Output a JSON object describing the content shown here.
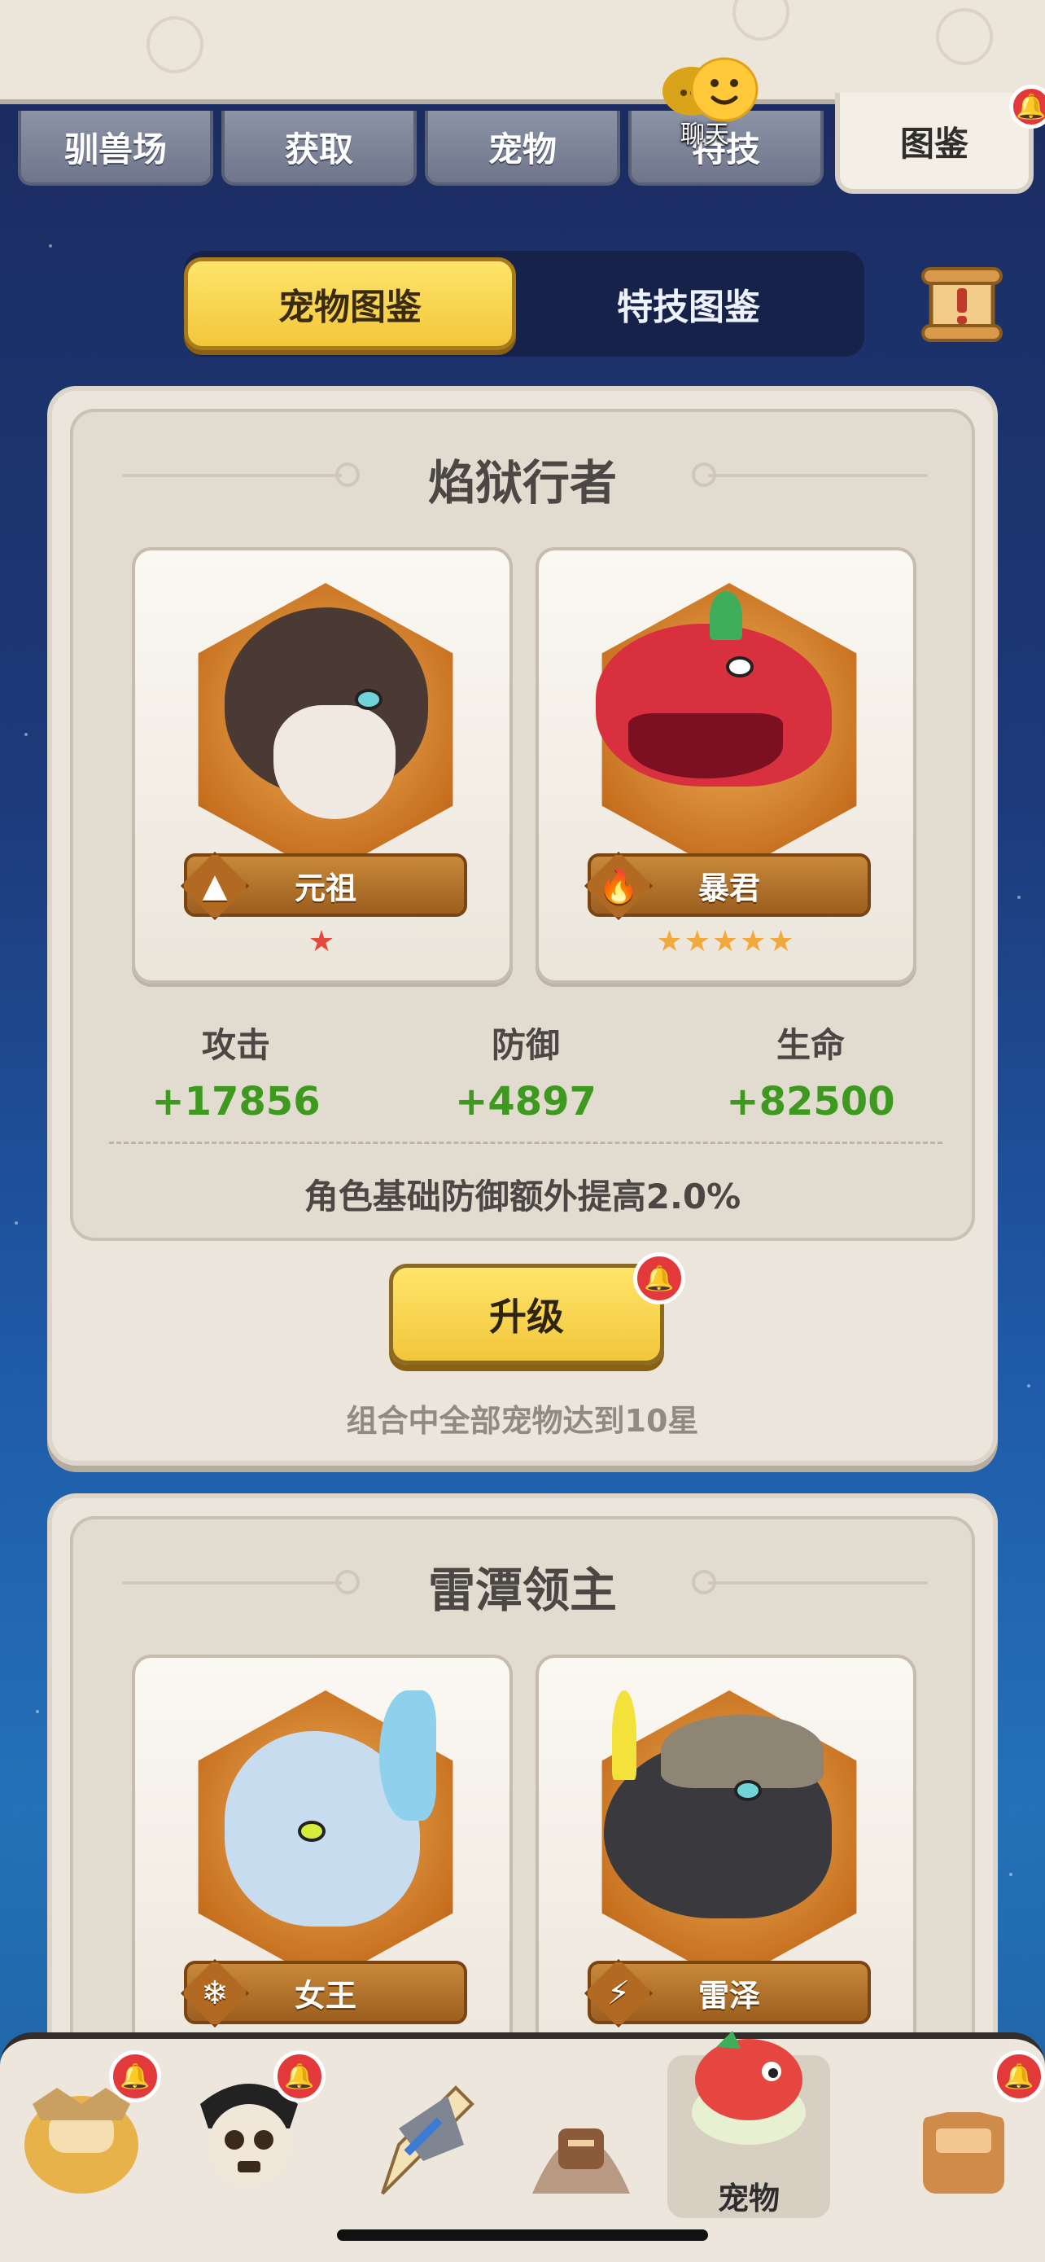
{
  "tabs": [
    {
      "label": "驯兽场"
    },
    {
      "label": "获取"
    },
    {
      "label": "宠物"
    },
    {
      "label": "特技"
    },
    {
      "label": "图鉴"
    }
  ],
  "chat": {
    "label": "聊天",
    "icon": "chat-bubble-icon"
  },
  "switcher": {
    "left": "宠物图鉴",
    "right": "特技图鉴"
  },
  "sets": [
    {
      "title": "焰狱行者",
      "pets": [
        {
          "name": "元祖",
          "element_icon": "earth-icon",
          "stars": "★",
          "star_count": 1
        },
        {
          "name": "暴君",
          "element_icon": "fire-icon",
          "stars": "★★★★★",
          "star_count": 5
        }
      ],
      "stats": [
        {
          "label": "攻击",
          "value": "+17856"
        },
        {
          "label": "防御",
          "value": "+4897"
        },
        {
          "label": "生命",
          "value": "+82500"
        }
      ],
      "bonus": "角色基础防御额外提高2.0%",
      "upgrade_label": "升级",
      "hint": "组合中全部宠物达到10星"
    },
    {
      "title": "雷潭领主",
      "pets": [
        {
          "name": "女王",
          "element_icon": "snowflake-icon"
        },
        {
          "name": "雷泽",
          "element_icon": "lightning-icon"
        }
      ]
    }
  ],
  "bottom_nav": [
    {
      "name": "nav-hero",
      "badge": true
    },
    {
      "name": "nav-skull",
      "badge": true
    },
    {
      "name": "nav-equip",
      "badge": false
    },
    {
      "name": "nav-monk",
      "badge": false
    },
    {
      "name": "nav-pet",
      "label": "宠物",
      "badge": false,
      "active": true
    },
    {
      "name": "nav-totem",
      "badge": true
    }
  ],
  "colors": {
    "accent_yellow": "#f2c63a",
    "stat_green": "#3d9a1e",
    "badge_red": "#e23a3a"
  }
}
